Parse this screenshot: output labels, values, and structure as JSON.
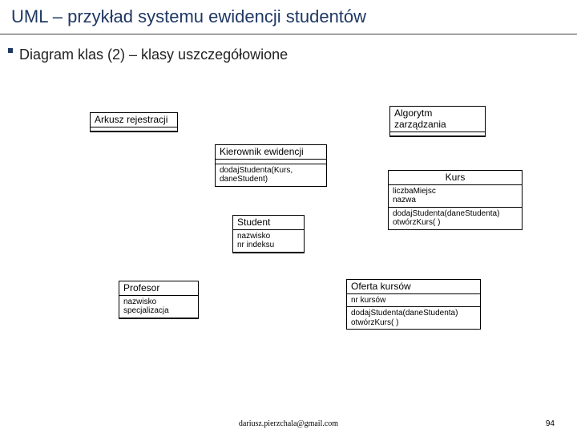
{
  "slide": {
    "title": "UML – przykład systemu ewidencji studentów",
    "subtitle": "Diagram klas (2) – klasy uszczegółowione"
  },
  "classes": {
    "arkusz": {
      "name": "Arkusz rejestracji",
      "attrs": "",
      "ops": ""
    },
    "algorytm": {
      "name": "Algorytm zarządzania",
      "attrs": "",
      "ops": ""
    },
    "kierownik": {
      "name": "Kierownik ewidencji",
      "attrs": "",
      "ops": "dodajStudenta(Kurs, daneStudent)"
    },
    "kurs": {
      "name": "Kurs",
      "attrs": "liczbaMiejsc\nnazwa",
      "ops": "dodajStudenta(daneStudenta)\notwórzKurs( )"
    },
    "student": {
      "name": "Student",
      "attrs": "nazwisko\nnr indeksu",
      "ops": ""
    },
    "profesor": {
      "name": "Profesor",
      "attrs": "nazwisko\nspecjalizacja",
      "ops": ""
    },
    "oferta": {
      "name": "Oferta kursów",
      "attrs": "nr kursów",
      "ops": "dodajStudenta(daneStudenta)\notwórzKurs( )"
    }
  },
  "footer": {
    "email": "dariusz.pierzchala@gmail.com",
    "page": "94"
  }
}
